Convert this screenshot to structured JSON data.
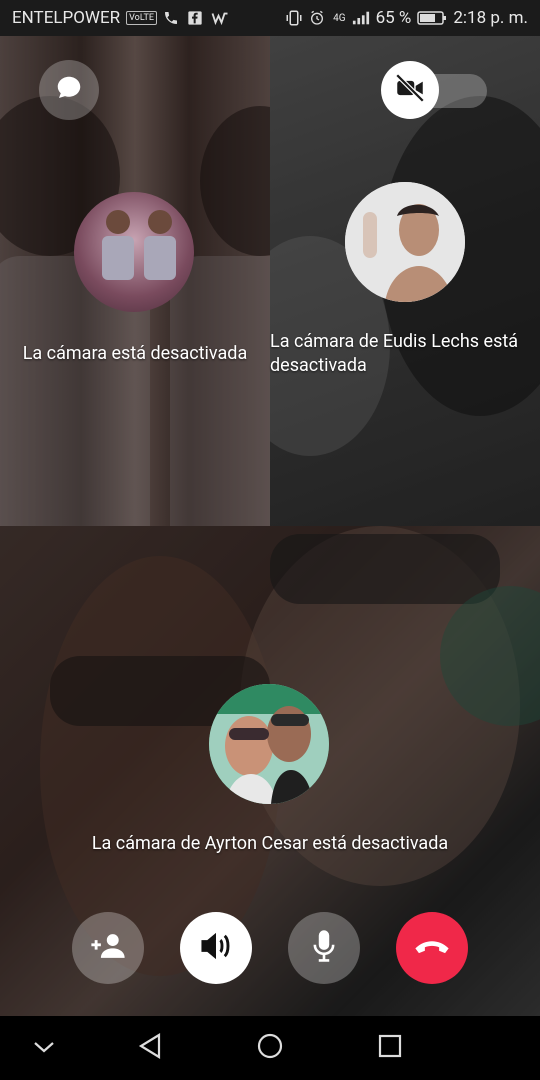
{
  "status_bar": {
    "carrier": "ENTELPOWER",
    "volte_label": "VoLTE",
    "network_label": "4G",
    "battery_percent": "65 %",
    "time": "2:18 p. m."
  },
  "participants": [
    {
      "camera_text": "La cámara está desactivada"
    },
    {
      "camera_text": "La cámara de Eudis Lechs está desactivada"
    },
    {
      "camera_text": "La cámara de Ayrton Cesar está desactivada"
    }
  ],
  "top_controls": {
    "chat_icon": "chat-bubble-icon",
    "camera_toggle_icon": "video-off-icon",
    "camera_on": false
  },
  "call_controls": {
    "add_person_icon": "add-person-icon",
    "speaker_icon": "speaker-icon",
    "mic_icon": "microphone-icon",
    "end_call_icon": "end-call-icon",
    "end_call_color": "#f02849"
  },
  "nav_bar": {
    "icons": [
      "chevron-down-icon",
      "back-icon",
      "home-icon",
      "recents-icon"
    ]
  }
}
